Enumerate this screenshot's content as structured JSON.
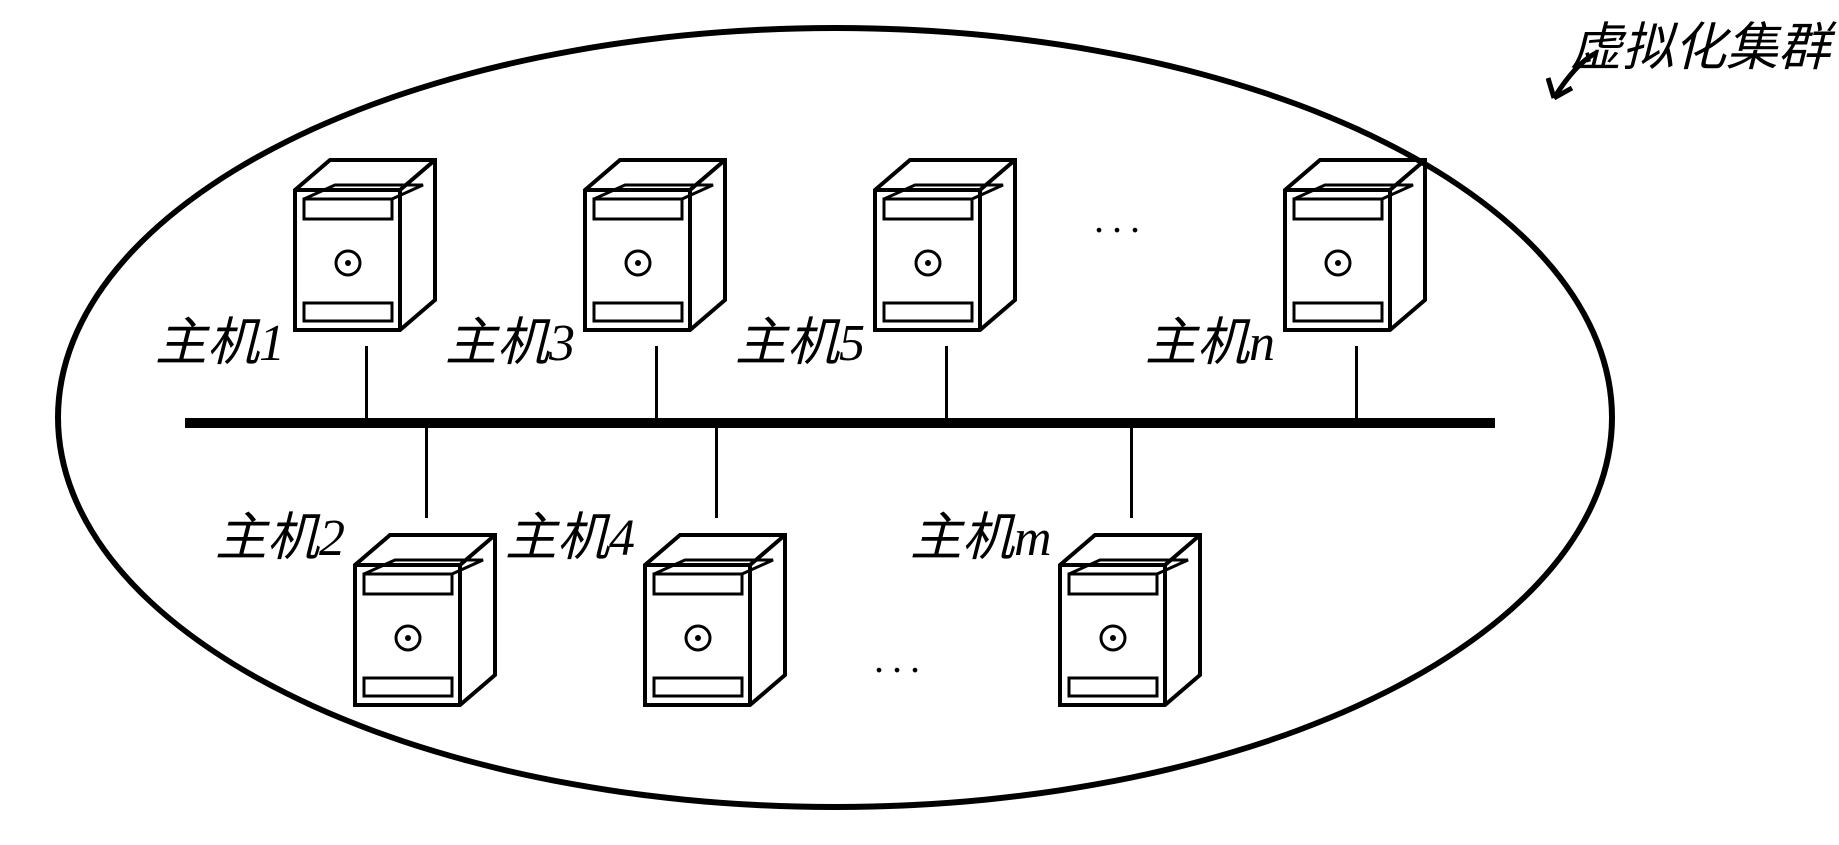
{
  "cluster_label": "虚拟化集群",
  "hosts_top": [
    {
      "label": "主机1"
    },
    {
      "label": "主机3"
    },
    {
      "label": "主机5"
    },
    {
      "label": "主机n"
    }
  ],
  "hosts_bottom": [
    {
      "label": "主机2"
    },
    {
      "label": "主机4"
    },
    {
      "label": "主机m"
    }
  ],
  "dots_top": "...",
  "dots_bottom": "..."
}
